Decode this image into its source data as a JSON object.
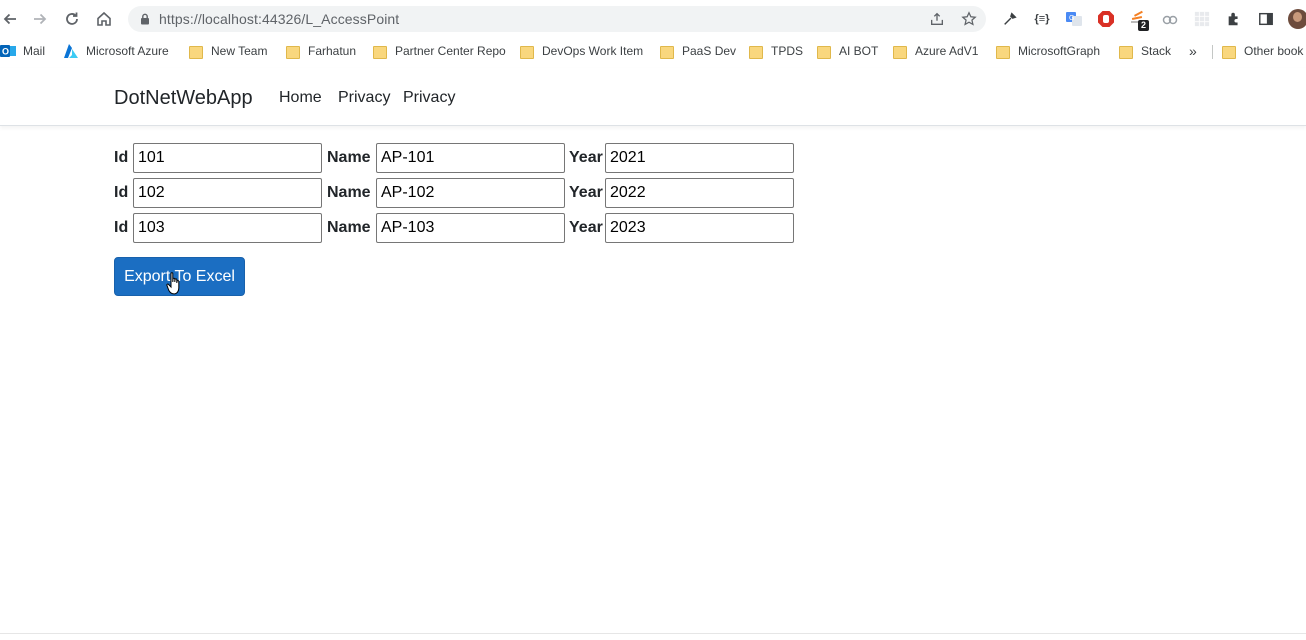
{
  "browser": {
    "url": "https://localhost:44326/L_AccessPoint",
    "extension_badge": "2",
    "bookmarks": [
      {
        "label": "Mail",
        "icon": "outlook-icon"
      },
      {
        "label": "Microsoft Azure",
        "icon": "azure-icon"
      },
      {
        "label": "New Team",
        "icon": "folder-icon"
      },
      {
        "label": "Farhatun",
        "icon": "folder-icon"
      },
      {
        "label": "Partner Center Repo",
        "icon": "folder-icon"
      },
      {
        "label": "DevOps Work Item",
        "icon": "folder-icon"
      },
      {
        "label": "PaaS Dev",
        "icon": "folder-icon"
      },
      {
        "label": "TPDS",
        "icon": "folder-icon"
      },
      {
        "label": "AI BOT",
        "icon": "folder-icon"
      },
      {
        "label": "Azure AdV1",
        "icon": "folder-icon"
      },
      {
        "label": "MicrosoftGraph",
        "icon": "folder-icon"
      },
      {
        "label": "Stack",
        "icon": "folder-icon"
      }
    ],
    "more_bookmarks": "»",
    "other_bookmarks": "Other book"
  },
  "site": {
    "brand": "DotNetWebApp",
    "nav": [
      "Home",
      "Privacy",
      "Privacy"
    ]
  },
  "form": {
    "id_label": "Id",
    "name_label": "Name",
    "year_label": "Year",
    "rows": [
      {
        "id": "101",
        "name": "AP-101",
        "year": "2021"
      },
      {
        "id": "102",
        "name": "AP-102",
        "year": "2022"
      },
      {
        "id": "103",
        "name": "AP-103",
        "year": "2023"
      }
    ]
  },
  "export_button": "Export To Excel",
  "colors": {
    "button": "#1b6ec2",
    "bookmark_folder": "#f9d77e"
  }
}
